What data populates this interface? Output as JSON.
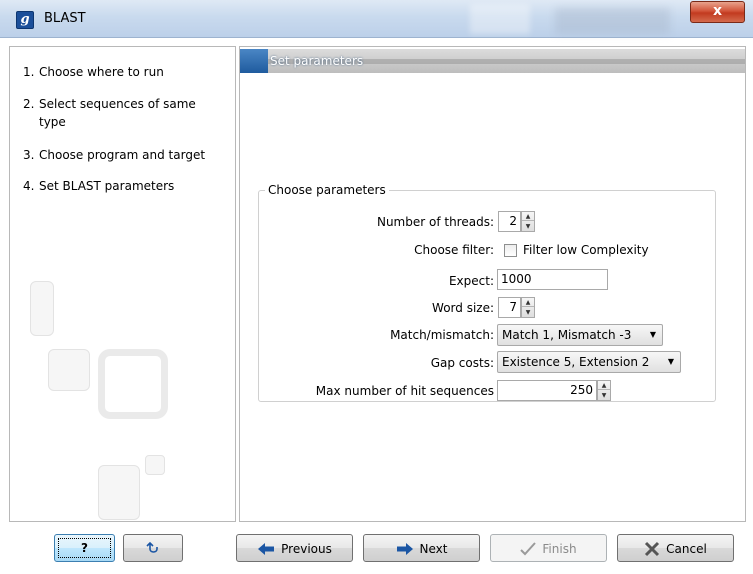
{
  "window": {
    "title": "BLAST",
    "icon_letter": "g",
    "close_glyph": "x"
  },
  "steps": [
    {
      "num": "1.",
      "label": "Choose where to run"
    },
    {
      "num": "2.",
      "label": "Select sequences of same type"
    },
    {
      "num": "3.",
      "label": "Choose program and target"
    },
    {
      "num": "4.",
      "label": "Set BLAST parameters"
    }
  ],
  "panel": {
    "header": "Set parameters",
    "group_title": "Choose parameters"
  },
  "params": {
    "threads": {
      "label": "Number of threads:",
      "value": "2"
    },
    "filter": {
      "label": "Choose filter:",
      "checkbox_label": "Filter low Complexity",
      "checked": false
    },
    "expect": {
      "label": "Expect:",
      "value": "1000"
    },
    "word_size": {
      "label": "Word size:",
      "value": "7"
    },
    "match": {
      "label": "Match/mismatch:",
      "value": "Match 1, Mismatch -3"
    },
    "gap": {
      "label": "Gap costs:",
      "value": "Existence 5, Extension 2"
    },
    "max_hits": {
      "label": "Max number of hit sequences",
      "value": "250"
    }
  },
  "buttons": {
    "help": "?",
    "previous": "Previous",
    "next": "Next",
    "finish": "Finish",
    "cancel": "Cancel"
  },
  "icons": {
    "app": "app-logo-icon",
    "close": "close-icon",
    "help": "help-icon",
    "reset": "reset-arrow-icon",
    "previous": "arrow-left-icon",
    "next": "arrow-right-icon",
    "finish": "checkmark-icon",
    "cancel": "cancel-x-icon"
  },
  "colors": {
    "accent": "#1f5b9e",
    "title_bar": "#c9daee",
    "close_button": "#c23a1f",
    "arrow": "#1b56a4"
  }
}
